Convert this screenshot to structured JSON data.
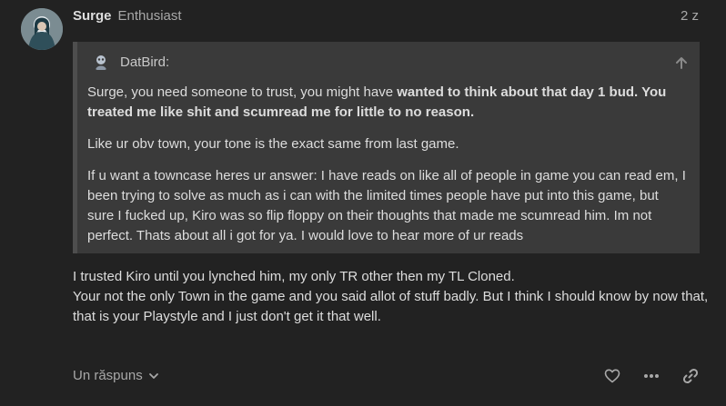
{
  "post": {
    "author": "Surge",
    "user_title": "Enthusiast",
    "date": "2 z",
    "quote": {
      "author": "DatBird:",
      "paragraphs": [
        {
          "plain": "Surge, you need someone to trust, you might have ",
          "bold": "wanted to think about that day 1 bud. You treated me like shit and scumread me for little to no reason."
        },
        {
          "plain": "Like ur obv town, your tone is the exact same from last game.",
          "bold": ""
        },
        {
          "plain": "If u want a towncase heres ur answer: I have reads on like all of people in game you can read em, I been trying to solve as much as i can with the limited times people have put into this game, but sure I fucked up, Kiro was so flip floppy on their thoughts that made me scumread him. Im not perfect. Thats about all i got for ya. I would love to hear more of ur reads",
          "bold": ""
        }
      ]
    },
    "body_lines": [
      "I trusted Kiro until you lynched him, my only TR other then my TL Cloned.",
      "Your not the only Town in the game and you said allot of stuff badly. But I think I should know by now that, that is your Playstyle and I just don't get it that well."
    ],
    "replies_label": "Un răspuns",
    "icons": {
      "avatar": "user-avatar",
      "quote_avatar": "quoted-user-avatar",
      "up": "arrow-up-icon",
      "chevron": "chevron-down-icon",
      "like": "heart-icon",
      "more": "ellipsis-icon",
      "link": "link-icon"
    }
  }
}
